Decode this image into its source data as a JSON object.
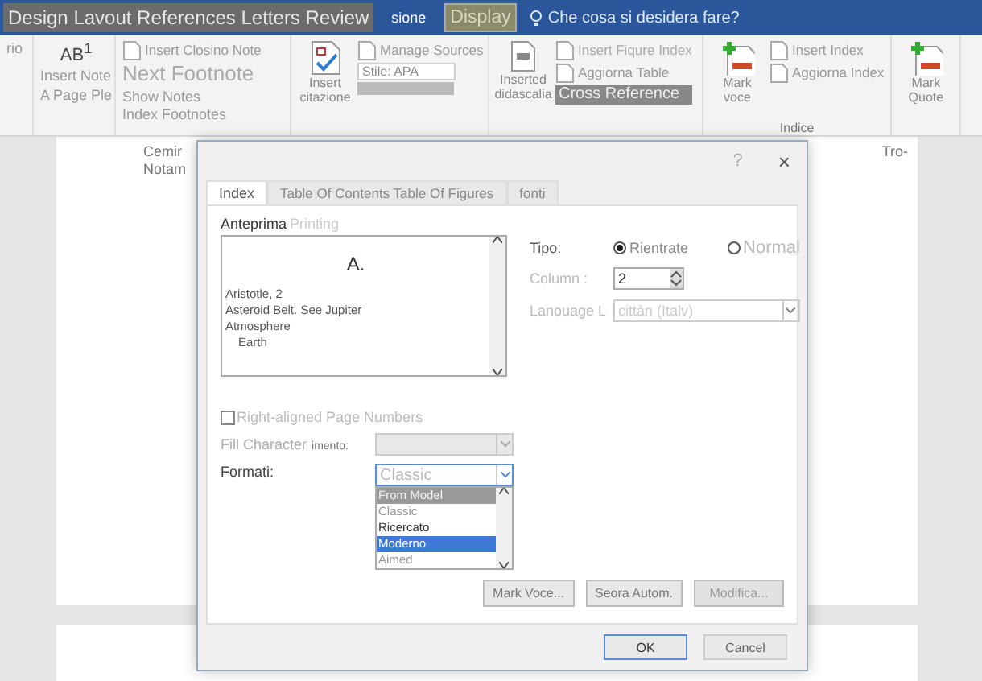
{
  "title_bar": {
    "tabs": [
      {
        "label": "Design Lavout References Letters Review",
        "selected": false
      },
      {
        "label": "sione",
        "selected": false
      },
      {
        "label": "Display",
        "selected": true
      }
    ],
    "tell_me": "Che cosa si desidera fare?"
  },
  "ribbon": {
    "groups": [
      {
        "columns": [
          [
            {
              "kind": "text",
              "label": "rio"
            }
          ]
        ]
      },
      {
        "columns": [
          [
            {
              "kind": "glyph",
              "label": "AB$^{1}$"
            },
            {
              "kind": "text",
              "label": "Insert Note"
            },
            {
              "kind": "text",
              "label": "A Page Ple"
            }
          ]
        ]
      },
      {
        "columns": [
          [
            {
              "kind": "small",
              "label": "Insert Closino Note"
            },
            {
              "kind": "big",
              "label": "Next Footnote"
            },
            {
              "kind": "text",
              "label": "Show Notes"
            },
            {
              "kind": "text",
              "label": "Index Footnotes"
            }
          ]
        ]
      },
      {
        "columns": [
          [
            {
              "kind": "cite",
              "label": "Insert citazione"
            }
          ],
          [
            {
              "kind": "small",
              "label": "Manage Sources"
            },
            {
              "kind": "field",
              "label": "Stile: APA"
            },
            {
              "kind": "blur"
            }
          ]
        ]
      },
      {
        "columns": [
          [
            {
              "kind": "caption",
              "label": "Inserted didascalia"
            }
          ],
          [
            {
              "kind": "medium",
              "label": "Insert Fiqure Index"
            },
            {
              "kind": "small",
              "label": "Aggiorna Table"
            },
            {
              "kind": "highlight",
              "label": "Cross Reference"
            }
          ]
        ]
      },
      {
        "columns": [
          [
            {
              "kind": "mark",
              "label": "Mark voce"
            }
          ],
          [
            {
              "kind": "small",
              "label": "Insert Index"
            },
            {
              "kind": "small",
              "label": "Aggiorna Index"
            }
          ]
        ],
        "footer": "Indice"
      },
      {
        "columns": [
          [
            {
              "kind": "mark",
              "label": "Mark Quote"
            }
          ]
        ]
      }
    ]
  },
  "document": {
    "left_lines": [
      "Cemir",
      "Notam"
    ],
    "right_line": "Tro-"
  },
  "dialog": {
    "help": "?",
    "close": "×",
    "tabs": [
      {
        "label": "Index",
        "selected": true
      },
      {
        "label": "Table Of Contents Table Of Figures",
        "selected": false
      },
      {
        "label": "fonti",
        "selected": false
      }
    ],
    "preview_label": "Anteprima",
    "preview_label_2": "Printing",
    "preview": {
      "heading": "A.",
      "entries": [
        {
          "text": "Aristotle, 2",
          "indented": false
        },
        {
          "text": "Asteroid Belt. See Jupiter",
          "indented": false
        },
        {
          "text": "Atmosphere",
          "indented": false
        },
        {
          "text": "Earth",
          "indented": true
        }
      ]
    },
    "type_label": "Tipo:",
    "types": [
      {
        "label": "Rientrate",
        "selected": true
      },
      {
        "label": "Normal",
        "selected": false
      }
    ],
    "columns_label": "Column :",
    "columns_value": "2",
    "language_label": "Lanouage L",
    "language_value": "cittàn (Italv)",
    "right_aligned": {
      "label": "Right-aligned Page Numbers",
      "checked": false
    },
    "fill_label": "Fill Character",
    "fill_label_2": "imento:",
    "fill_disabled": true,
    "formats_label": "Formati:",
    "formats_value": "Classic",
    "format_options": [
      {
        "label": "From Model",
        "selected": false,
        "highlighted": true
      },
      {
        "label": "Classic",
        "selected": false,
        "highlighted": false
      },
      {
        "label": "Ricercato",
        "selected": false,
        "highlighted": false
      },
      {
        "label": "Moderno",
        "selected": true,
        "highlighted": false
      },
      {
        "label": "Aimed",
        "selected": false,
        "highlighted": false
      }
    ],
    "action_buttons": [
      {
        "label": "Mark Voce...",
        "disabled": false
      },
      {
        "label": "Seora Autom.",
        "disabled": false
      },
      {
        "label": "Modifica...",
        "disabled": true
      }
    ],
    "ok": "OK",
    "cancel": "Cancel"
  }
}
